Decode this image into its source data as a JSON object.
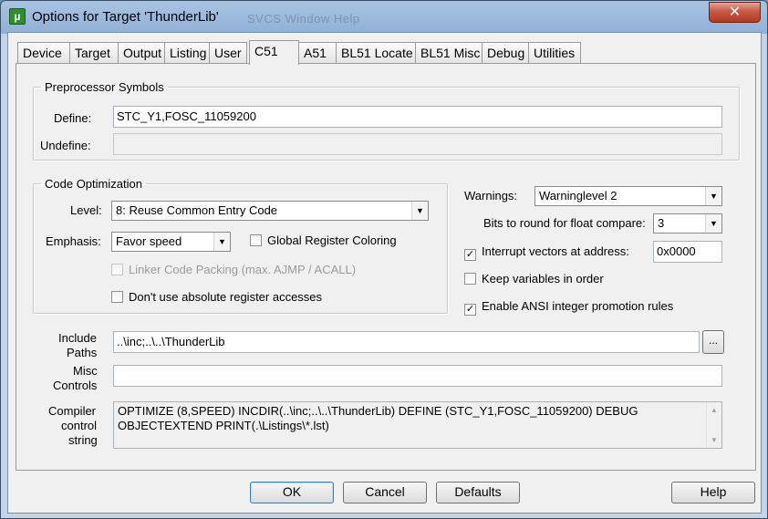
{
  "window": {
    "title": "Options for Target 'ThunderLib'",
    "app_icon": "µ",
    "ghost_menu": "SVCS    Window    Help",
    "close_glyph": "✕"
  },
  "tabs": [
    {
      "label": "Device"
    },
    {
      "label": "Target"
    },
    {
      "label": "Output"
    },
    {
      "label": "Listing"
    },
    {
      "label": "User"
    },
    {
      "label": "C51"
    },
    {
      "label": "A51"
    },
    {
      "label": "BL51 Locate"
    },
    {
      "label": "BL51 Misc"
    },
    {
      "label": "Debug"
    },
    {
      "label": "Utilities"
    }
  ],
  "active_tab": "C51",
  "preprocessor": {
    "legend": "Preprocessor Symbols",
    "define_label": "Define:",
    "define_value": "STC_Y1,FOSC_11059200",
    "undefine_label": "Undefine:",
    "undefine_value": ""
  },
  "optimization": {
    "legend": "Code Optimization",
    "level_label": "Level:",
    "level_value": "8: Reuse Common Entry Code",
    "emphasis_label": "Emphasis:",
    "emphasis_value": "Favor speed",
    "global_register_coloring": {
      "label": "Global Register Coloring",
      "checked": false
    },
    "linker_code_packing": {
      "label": "Linker Code Packing (max. AJMP / ACALL)",
      "checked": false,
      "disabled": true
    },
    "no_absolute_register": {
      "label": "Don't use absolute register accesses",
      "checked": false
    }
  },
  "right_options": {
    "warnings_label": "Warnings:",
    "warnings_value": "Warninglevel 2",
    "bits_label": "Bits to round for float compare:",
    "bits_value": "3",
    "interrupt_vectors": {
      "label": "Interrupt vectors at address:",
      "checked": true,
      "value": "0x0000"
    },
    "keep_variables": {
      "label": "Keep variables in order",
      "checked": false
    },
    "ansi_promotion": {
      "label": "Enable ANSI integer promotion rules",
      "checked": true
    }
  },
  "paths": {
    "include_label_1": "Include",
    "include_label_2": "Paths",
    "include_value": "..\\inc;..\\..\\ThunderLib",
    "browse_label": "...",
    "misc_label_1": "Misc",
    "misc_label_2": "Controls",
    "misc_value": "",
    "compiler_label_1": "Compiler",
    "compiler_label_2": "control",
    "compiler_label_3": "string",
    "compiler_line_1": "OPTIMIZE (8,SPEED) INCDIR(..\\inc;..\\..\\ThunderLib) DEFINE (STC_Y1,FOSC_11059200) DEBUG",
    "compiler_line_2": "OBJECTEXTEND PRINT(.\\Listings\\*.lst)"
  },
  "buttons": {
    "ok": "OK",
    "cancel": "Cancel",
    "defaults": "Defaults",
    "help": "Help"
  },
  "glyphs": {
    "check": "✓",
    "dropdown": "▼",
    "scroll_up": "▲",
    "scroll_down": "▼"
  }
}
